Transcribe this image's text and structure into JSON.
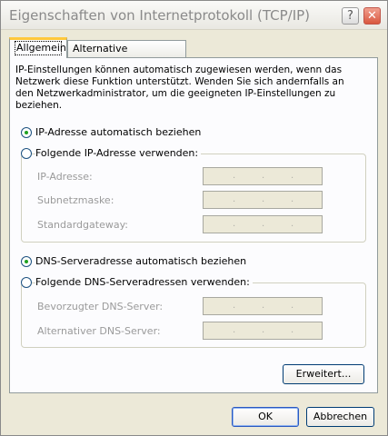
{
  "window": {
    "title": "Eigenschaften von Internetprotokoll (TCP/IP)",
    "help_icon": "?",
    "close_icon": "✕"
  },
  "tabs": [
    {
      "label": "Allgemein"
    },
    {
      "label": "Alternative Konfiguration"
    }
  ],
  "intro": "IP-Einstellungen können automatisch zugewiesen werden, wenn das Netzwerk diese Funktion unterstützt. Wenden Sie sich andernfalls an den Netzwerkadministrator, um die geeigneten IP-Einstellungen zu beziehen.",
  "ip": {
    "auto_label": "IP-Adresse automatisch beziehen",
    "manual_label": "Folgende IP-Adresse verwenden:",
    "selected": "auto",
    "fields": [
      {
        "label": "IP-Adresse:",
        "value": ""
      },
      {
        "label": "Subnetzmaske:",
        "value": ""
      },
      {
        "label": "Standardgateway:",
        "value": ""
      }
    ]
  },
  "dns": {
    "auto_label": "DNS-Serveradresse automatisch beziehen",
    "manual_label": "Folgende DNS-Serveradressen verwenden:",
    "selected": "auto",
    "fields": [
      {
        "label": "Bevorzugter DNS-Server:",
        "value": ""
      },
      {
        "label": "Alternativer DNS-Server:",
        "value": ""
      }
    ]
  },
  "buttons": {
    "advanced": "Erweitert...",
    "ok": "OK",
    "cancel": "Abbrechen"
  },
  "colors": {
    "dialog_bg": "#ece9d8",
    "tab_highlight": "#ffc83c",
    "radio_selected": "#21a121"
  }
}
